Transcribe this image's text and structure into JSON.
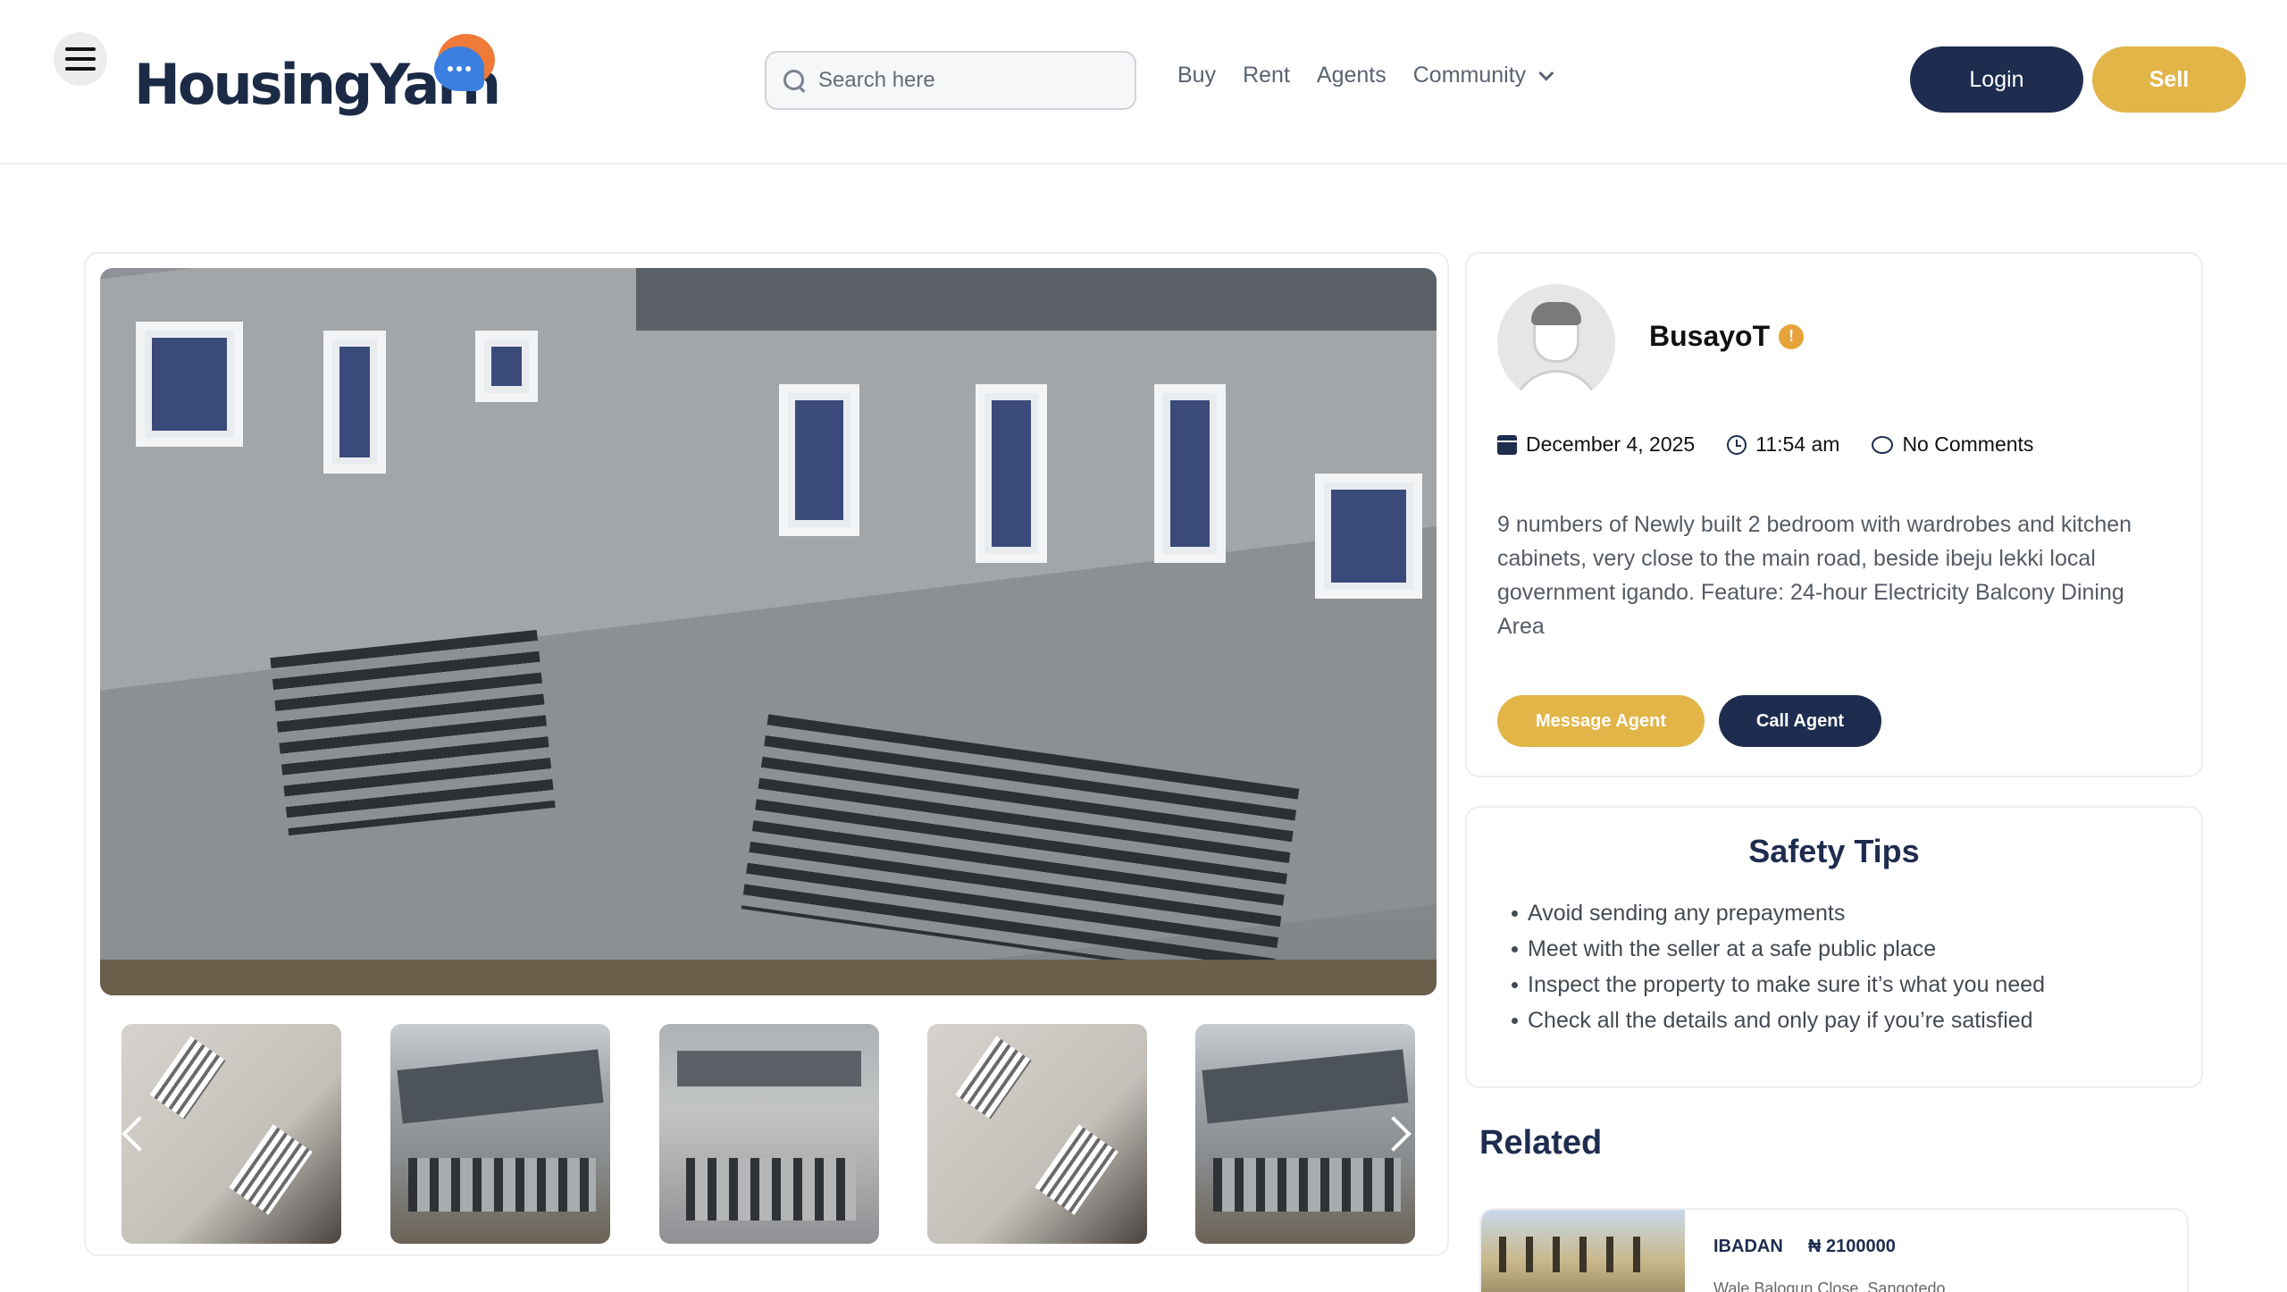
{
  "header": {
    "logo_text": "HousingYarn",
    "search": {
      "placeholder": "Search here"
    },
    "nav": [
      {
        "label": "Buy"
      },
      {
        "label": "Rent"
      },
      {
        "label": "Agents"
      },
      {
        "label": "Community"
      }
    ],
    "login_label": "Login",
    "sell_label": "Sell"
  },
  "agent": {
    "name": "BusayoT",
    "badge": "!",
    "date": "December 4, 2025",
    "time": "11:54 am",
    "comments": "No Comments",
    "description": "9 numbers of Newly built 2 bedroom with wardrobes and kitchen cabinets, very close to the main road, beside ibeju lekki local government igando. Feature: 24-hour Electricity Balcony Dining Area",
    "message_label": "Message Agent",
    "call_label": "Call Agent"
  },
  "safety": {
    "title": "Safety Tips",
    "tips": [
      "Avoid sending any prepayments",
      "Meet with the seller at a safe public place",
      "Inspect the property to make sure it’s what you need",
      "Check all the details and only pay if you’re satisfied"
    ]
  },
  "related": {
    "title": "Related",
    "items": [
      {
        "city": "IBADAN",
        "price": "₦ 2100000",
        "address": "Wale Balogun Close, Sangotedo"
      }
    ]
  },
  "colors": {
    "navy": "#1e2d4f",
    "gold": "#e2b549"
  }
}
